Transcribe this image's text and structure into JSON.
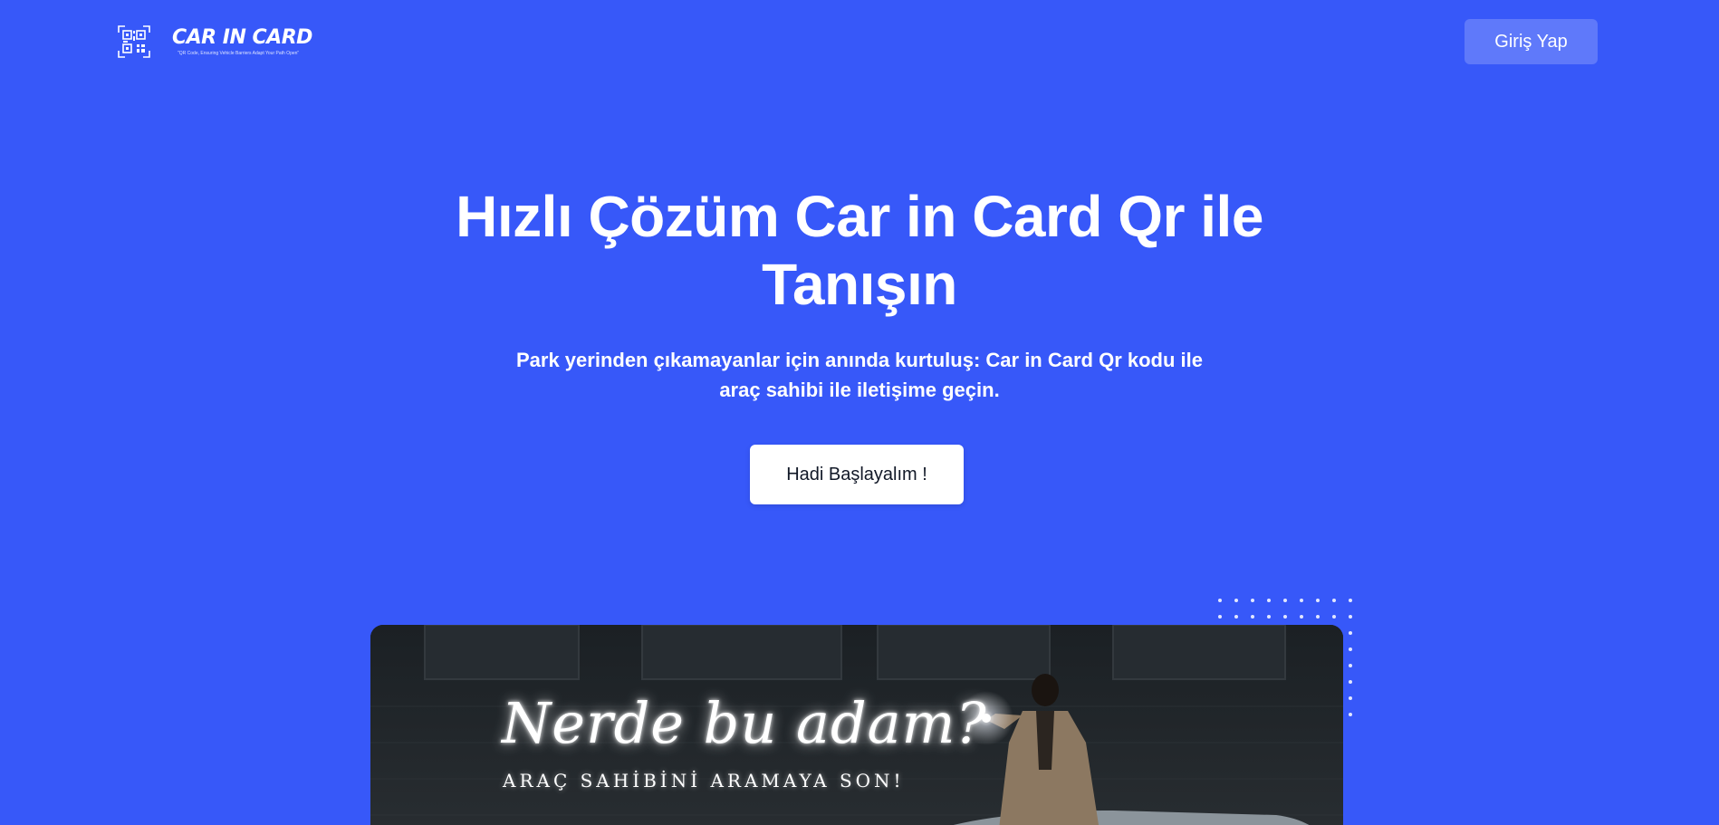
{
  "header": {
    "logo_title": "CAR IN CARD",
    "logo_tagline": "\"QR Code, Ensuring Vehicle Barriers Adapt Your Path Open\"",
    "login_label": "Giriş Yap"
  },
  "hero": {
    "title": "Hızlı Çözüm Car in Card Qr ile Tanışın",
    "subtitle": "Park yerinden çıkamayanlar için anında kurtuluş: Car in Card Qr kodu ile araç sahibi ile iletişime geçin.",
    "cta_label": "Hadi Başlayalım !"
  },
  "hero_image": {
    "headline": "Nerde bu adam?",
    "subline": "ARAÇ SAHİBİNİ ARAMAYA SON!"
  },
  "colors": {
    "background": "#3758f9",
    "cta_background": "#ffffff",
    "login_background": "rgba(255,255,255,0.2)"
  },
  "icons": {
    "logo": "qr-code-icon",
    "decoration": "dot-grid"
  }
}
